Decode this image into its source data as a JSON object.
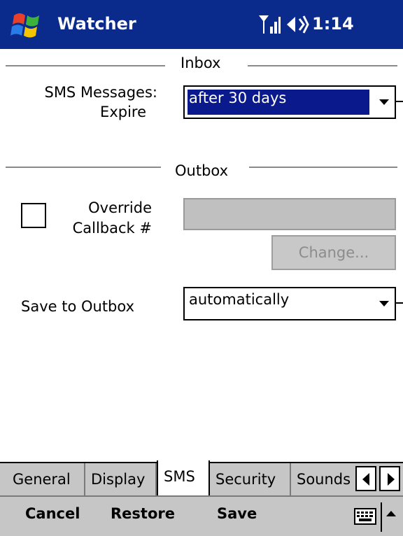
{
  "title_bar": {
    "app_title": "Watcher",
    "clock": "1:14",
    "start_icon": "windows-flag-icon",
    "signal_icon": "signal-icon",
    "volume_icon": "speaker-icon"
  },
  "inbox": {
    "section_label": "Inbox",
    "sms_label_line1": "SMS Messages:",
    "sms_label_line2": "Expire",
    "expire_value": "after 30 days"
  },
  "outbox": {
    "section_label": "Outbox",
    "override_label_line1": "Override",
    "override_label_line2": "Callback #",
    "override_checked": false,
    "callback_value": "",
    "change_button": "Change...",
    "save_label": "Save to Outbox",
    "save_value": "automatically"
  },
  "tabs": [
    {
      "label": "General",
      "active": false
    },
    {
      "label": "Display",
      "active": false
    },
    {
      "label": "SMS",
      "active": true
    },
    {
      "label": "Security",
      "active": false
    },
    {
      "label": "Sounds",
      "active": false
    }
  ],
  "menu": {
    "cancel": "Cancel",
    "restore": "Restore",
    "save": "Save",
    "keyboard_icon": "keyboard-icon"
  },
  "colors": {
    "title_bar": "#0a2a8c",
    "selection": "#0a1a8c",
    "chrome": "#c6c6c6"
  }
}
